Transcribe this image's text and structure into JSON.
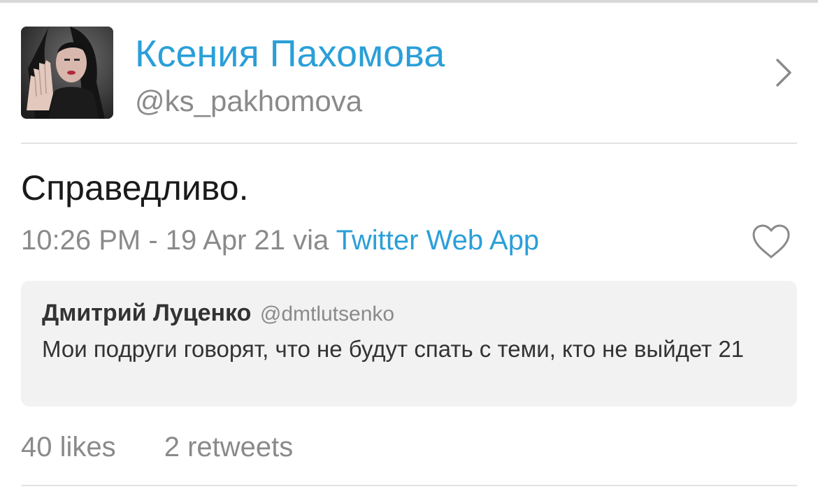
{
  "profile": {
    "display_name": "Ксения Пахомова",
    "handle": "@ks_pakhomova",
    "avatar_icon": "user-photo",
    "chevron_icon": "chevron-right-icon"
  },
  "tweet": {
    "text": "Справедливо.",
    "timestamp": "10:26 PM - 19 Apr 21",
    "via_label": "via",
    "source": "Twitter Web App",
    "like_icon": "heart-outline-icon"
  },
  "quoted_tweet": {
    "author_name": "Дмитрий Луценко",
    "author_handle": "@dmtlutsenko",
    "text": "Мои подруги говорят, что не будут спать с теми, кто не выйдет 21"
  },
  "stats": {
    "likes": "40 likes",
    "retweets": "2 retweets"
  },
  "colors": {
    "accent": "#2a9fd8",
    "muted": "#8a8a8a",
    "quote_bg": "#f2f2f2",
    "divider": "#e3e3e3"
  }
}
